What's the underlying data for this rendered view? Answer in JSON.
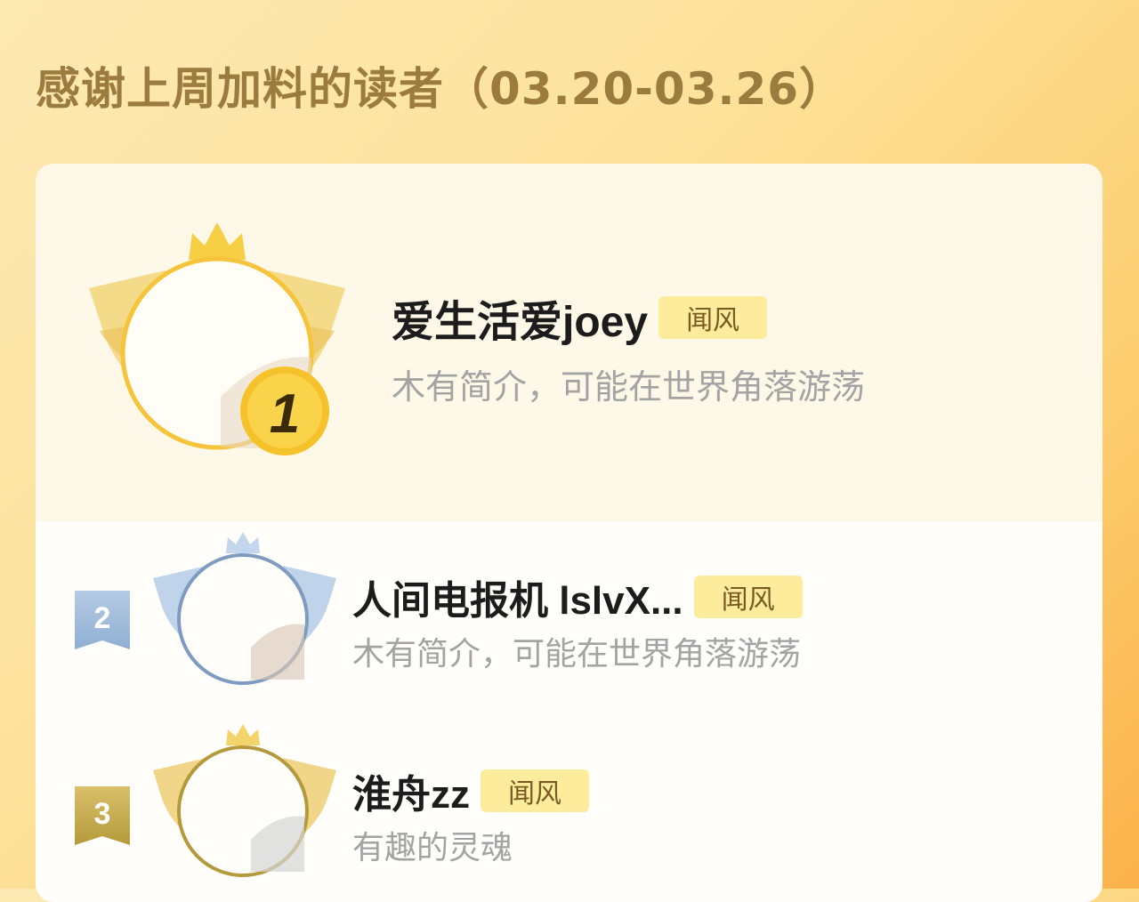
{
  "header": {
    "title": "感谢上周加料的读者（03.20-03.26）"
  },
  "readers": [
    {
      "rank": "1",
      "name": "爱生活爱joey",
      "tag": "闻风",
      "bio": "木有简介，可能在世界角落游荡"
    },
    {
      "rank": "2",
      "name": "人间电报机  lslvX...",
      "tag": "闻风",
      "bio": "木有简介，可能在世界角落游荡"
    },
    {
      "rank": "3",
      "name": "淮舟zz",
      "tag": "闻风",
      "bio": "有趣的灵魂"
    }
  ],
  "colors": {
    "gold": "#f5c43a",
    "silver": "#7f9cc0",
    "bronze": "#b49a3c",
    "tag_bg": "#fcec9c"
  }
}
